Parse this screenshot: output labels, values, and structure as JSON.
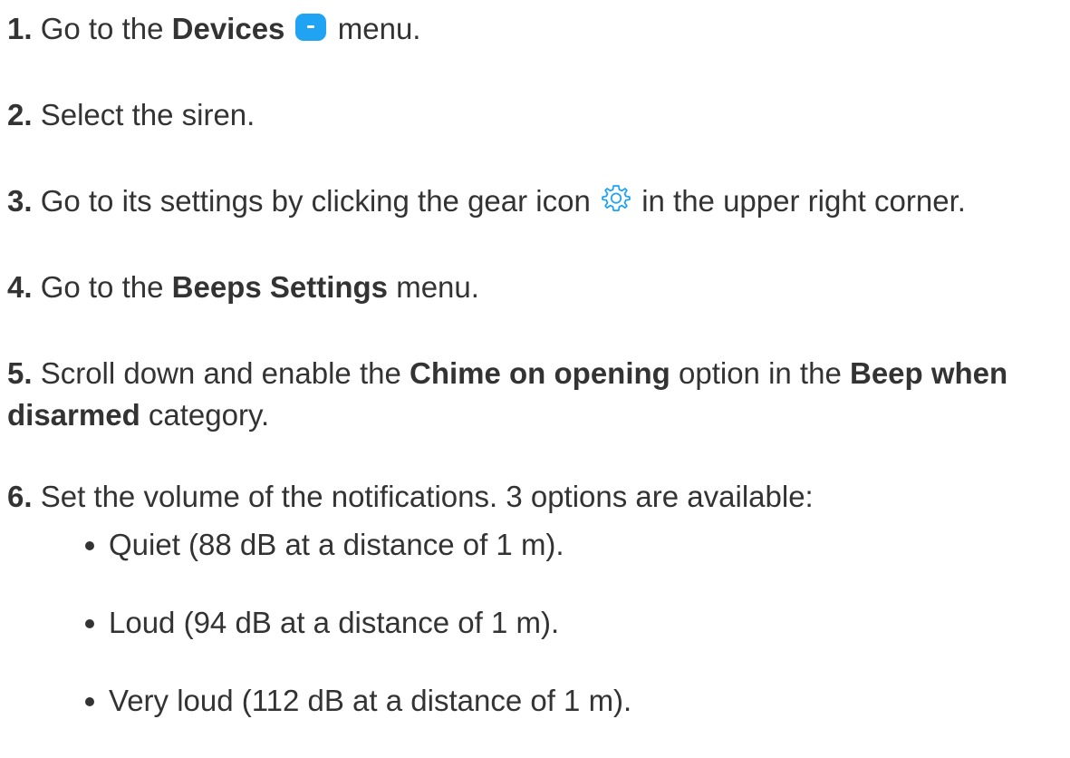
{
  "steps": [
    {
      "number": "1.",
      "before": "Go to the",
      "bold": "Devices",
      "icon": "devices-icon",
      "after": "menu."
    },
    {
      "number": "2.",
      "text": "Select the siren."
    },
    {
      "number": "3.",
      "before": "Go to its settings by clicking the gear icon",
      "icon": "gear-icon",
      "after": "in the upper right corner."
    },
    {
      "number": "4.",
      "before": "Go to the",
      "bold": "Beeps Settings",
      "after": "menu."
    },
    {
      "number": "5.",
      "before": "Scroll down and enable the",
      "bold1": "Chime on opening",
      "middle": "option in the",
      "bold2": "Beep when disarmed",
      "after": "category."
    },
    {
      "number": "6.",
      "text": "Set the volume of the notifications. 3 options are available:"
    }
  ],
  "volume_options": [
    "Quiet (88 dB at a distance of 1 m).",
    "Loud (94 dB at a distance of 1 m).",
    "Very loud (112 dB at a distance of 1 m)."
  ],
  "colors": {
    "text": "#333333",
    "accent": "#1fa3f2"
  }
}
